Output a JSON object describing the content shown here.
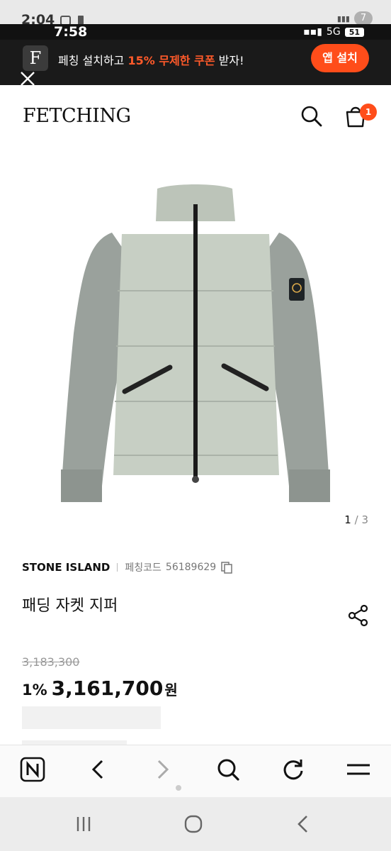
{
  "outer_status": {
    "time": "2:04",
    "badge": "7"
  },
  "inner_status": {
    "time": "7:58",
    "network": "5G",
    "battery": "51"
  },
  "promo": {
    "logo_letter": "F",
    "text_before": "페칭 설치하고 ",
    "text_highlight": "15% 무제한 쿠폰",
    "text_after": " 받자!",
    "button_label": "앱 설치",
    "accent_color": "#ff4d1a"
  },
  "header": {
    "logo": "FETCHING",
    "cart_count": "1"
  },
  "gallery": {
    "current": "1",
    "separator": "/",
    "total": "3"
  },
  "product": {
    "brand": "STONE ISLAND",
    "fetching_code_label": "페칭코드",
    "fetching_code": "56189629",
    "name": "패딩 자켓 지퍼",
    "original_price": "3,183,300",
    "discount": "1%",
    "price": "3,161,700",
    "currency": "원"
  },
  "toolbar": {
    "items": [
      "naver-icon",
      "back-icon",
      "forward-icon",
      "search-icon",
      "refresh-icon",
      "menu-icon"
    ]
  },
  "navbar": {
    "items": [
      "recent-apps-icon",
      "home-icon",
      "back-icon"
    ]
  }
}
